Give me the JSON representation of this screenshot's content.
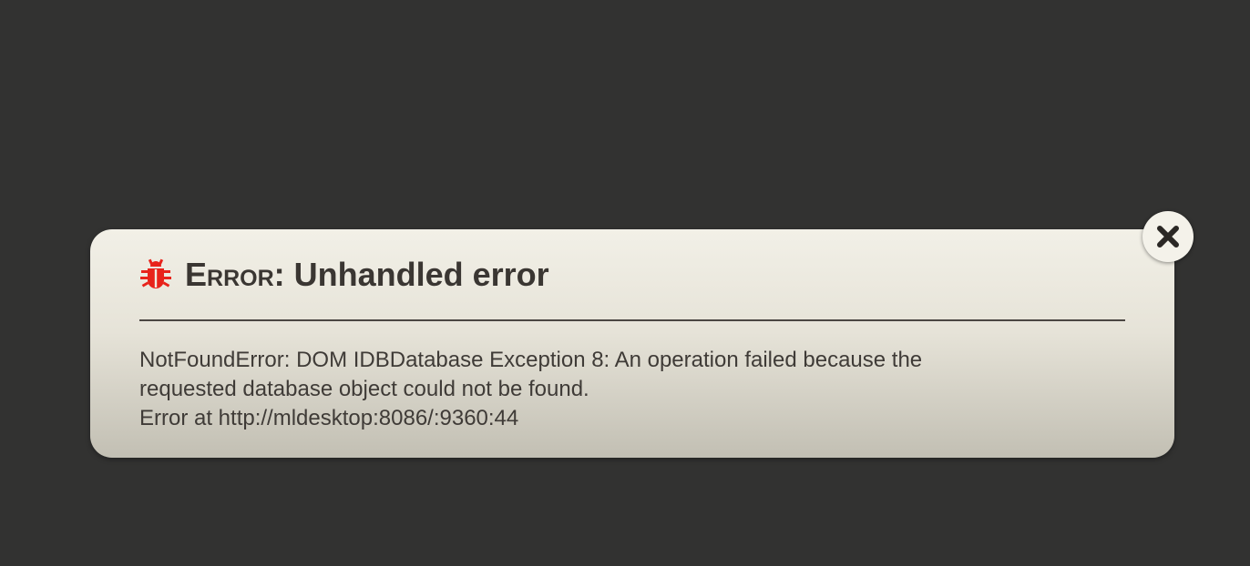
{
  "dialog": {
    "title_kind": "Error",
    "title_separator": ": ",
    "title_text": "Unhandled error",
    "message_lines": [
      "NotFoundError: DOM IDBDatabase Exception 8: An operation failed because the",
      "requested database object could not be found.",
      "Error at http://mldesktop:8086/:9360:44"
    ],
    "header_icon": "bug-icon",
    "close_icon": "close-icon"
  },
  "colors": {
    "backdrop": "#323231",
    "icon_accent": "#e8231b",
    "text": "#3a3632"
  }
}
